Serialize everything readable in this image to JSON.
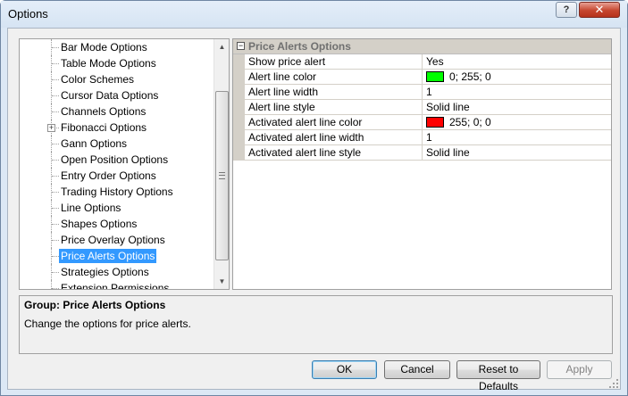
{
  "window": {
    "title": "Options"
  },
  "titlebar": {
    "help_label": "?",
    "close_label": "✕"
  },
  "tree": {
    "items": [
      {
        "label": "Bar Mode Options"
      },
      {
        "label": "Table Mode Options"
      },
      {
        "label": "Color Schemes"
      },
      {
        "label": "Cursor Data Options"
      },
      {
        "label": "Channels Options"
      },
      {
        "label": "Fibonacci Options",
        "expander": "+"
      },
      {
        "label": "Gann Options"
      },
      {
        "label": "Open Position Options"
      },
      {
        "label": "Entry Order Options"
      },
      {
        "label": "Trading History Options"
      },
      {
        "label": "Line Options"
      },
      {
        "label": "Shapes Options"
      },
      {
        "label": "Price Overlay Options"
      },
      {
        "label": "Price Alerts Options",
        "selected": true
      },
      {
        "label": "Strategies Options"
      },
      {
        "label": "Extension Permissions"
      }
    ]
  },
  "grid": {
    "header": "Price Alerts Options",
    "collapse_symbol": "−",
    "rows": [
      {
        "name": "Show price alert",
        "value": "Yes"
      },
      {
        "name": "Alert line color",
        "value": "0; 255; 0",
        "swatch": "#00ff00"
      },
      {
        "name": "Alert line width",
        "value": "1"
      },
      {
        "name": "Alert line style",
        "value": "Solid line"
      },
      {
        "name": "Activated alert line color",
        "value": "255; 0; 0",
        "swatch": "#ff0000"
      },
      {
        "name": "Activated alert line width",
        "value": "1"
      },
      {
        "name": "Activated alert line style",
        "value": "Solid line"
      }
    ]
  },
  "description": {
    "title": "Group: Price Alerts Options",
    "text": "Change the options for price alerts."
  },
  "buttons": {
    "ok": "OK",
    "cancel": "Cancel",
    "reset": "Reset to Defaults",
    "apply": "Apply"
  },
  "colors": {
    "selection": "#3399ff",
    "window_frame": "#dce8f5"
  }
}
